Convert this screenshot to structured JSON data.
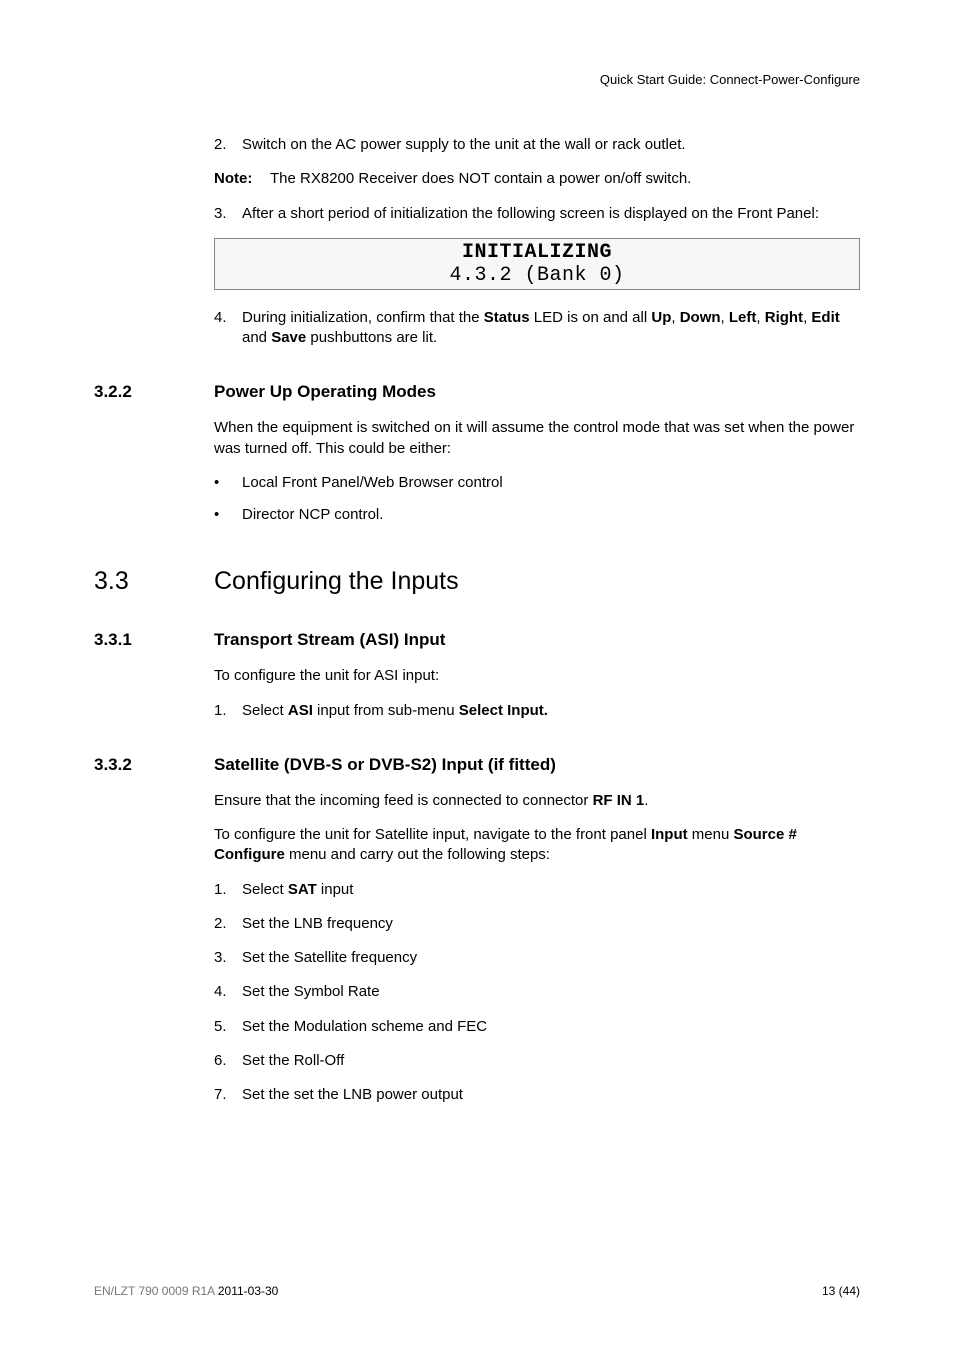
{
  "header": {
    "right": "Quick Start Guide: Connect-Power-Configure"
  },
  "top": {
    "item2_num": "2.",
    "item2_txt": "Switch on the AC power supply to the unit at the wall or rack outlet.",
    "note_label": "Note:",
    "note_txt": "The RX8200 Receiver does NOT contain a power on/off switch.",
    "item3_num": "3.",
    "item3_txt": "After a short period of initialization the following screen is displayed on the Front Panel:",
    "lcd_line1": "INITIALIZING",
    "lcd_line2": "4.3.2 (Bank 0)",
    "item4_num": "4.",
    "item4_pre": "During initialization, confirm that the ",
    "item4_status": "Status",
    "item4_mid1": " LED is on and all ",
    "item4_up": "Up",
    "item4_c1": ", ",
    "item4_down": "Down",
    "item4_c2": ", ",
    "item4_left": "Left",
    "item4_c3": ", ",
    "item4_right": "Right",
    "item4_c4": ", ",
    "item4_edit": "Edit",
    "item4_and": " and ",
    "item4_save": "Save",
    "item4_post": " pushbuttons are lit."
  },
  "s322": {
    "num": "3.2.2",
    "title": "Power Up Operating Modes",
    "p1": "When the equipment is switched on it will assume the control mode that was set when the power was turned off. This could be either:",
    "b1": "Local Front Panel/Web Browser control",
    "b2": "Director NCP control."
  },
  "s33": {
    "num": "3.3",
    "title": "Configuring the Inputs"
  },
  "s331": {
    "num": "3.3.1",
    "title": "Transport Stream (ASI) Input",
    "p1": "To configure the unit for ASI input:",
    "i1_num": "1.",
    "i1_pre": "Select ",
    "i1_asi": "ASI",
    "i1_mid": " input from sub-menu ",
    "i1_sel": "Select Input."
  },
  "s332": {
    "num": "3.3.2",
    "title": "Satellite (DVB-S or DVB-S2) Input (if fitted)",
    "p1_pre": "Ensure that the incoming feed is connected to connector ",
    "p1_rf": "RF IN 1",
    "p1_post": ".",
    "p2_pre": "To configure the unit for Satellite input, navigate to the front panel ",
    "p2_input": "Input",
    "p2_mid": " menu ",
    "p2_src": "Source # Configure",
    "p2_post": " menu and carry out the following steps:",
    "i1_num": "1.",
    "i1_pre": "Select ",
    "i1_sat": "SAT",
    "i1_post": " input",
    "i2_num": "2.",
    "i2": "Set the LNB frequency",
    "i3_num": "3.",
    "i3": "Set the Satellite frequency",
    "i4_num": "4.",
    "i4": "Set the Symbol Rate",
    "i5_num": "5.",
    "i5": "Set the Modulation scheme and FEC",
    "i6_num": "6.",
    "i6": "Set the Roll-Off",
    "i7_num": "7.",
    "i7": "Set the set the LNB power output"
  },
  "footer": {
    "left_grey": "EN/LZT 790 0009 R1A ",
    "left_dark": "2011-03-30",
    "right": "13 (44)"
  },
  "glyphs": {
    "bullet": "•"
  }
}
